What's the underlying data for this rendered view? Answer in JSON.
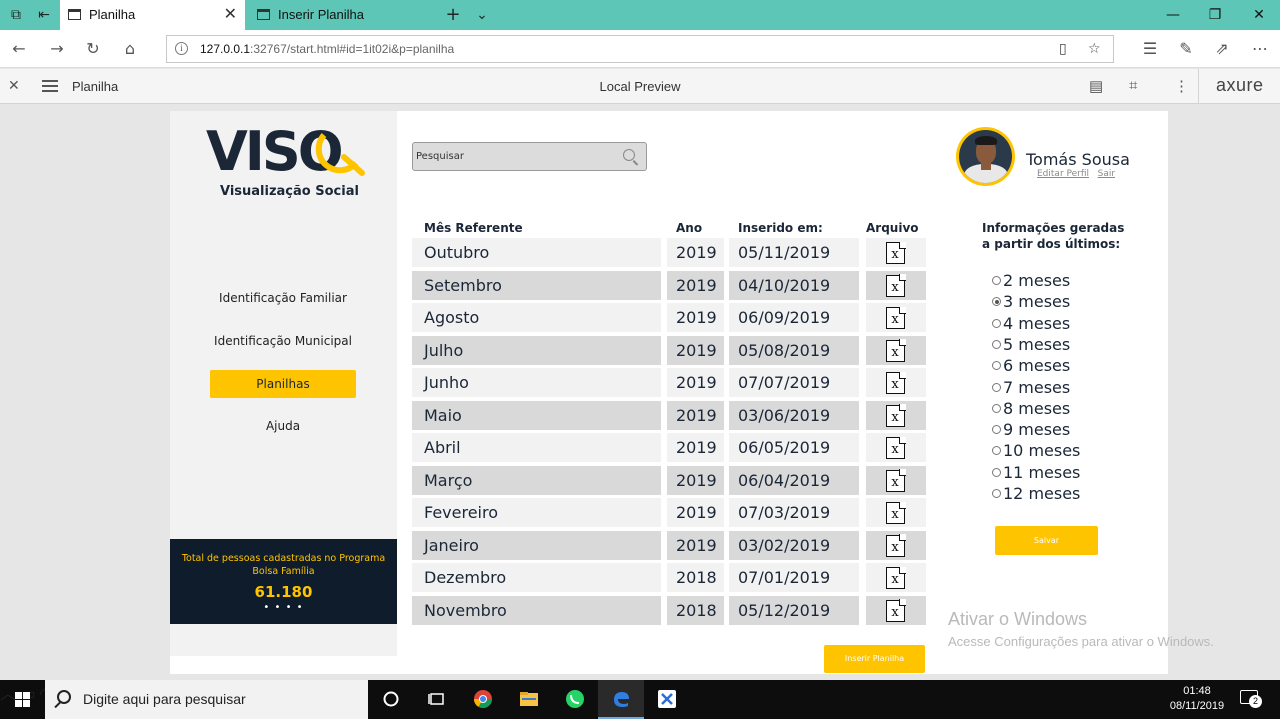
{
  "browser": {
    "tabs": [
      {
        "label": "Planilha"
      },
      {
        "label": "Inserir Planilha"
      }
    ],
    "url_host": "127.0.0.1",
    "url_rest": ":32767/start.html#id=1it02i&p=planilha"
  },
  "axure": {
    "page_name": "Planilha",
    "center_title": "Local Preview",
    "brand": "axure"
  },
  "sidebar": {
    "logo_text": "VISO",
    "logo_subtitle": "Visualização Social",
    "items": [
      {
        "label": "Identificação Familiar",
        "active": false
      },
      {
        "label": "Identificação Municipal",
        "active": false
      },
      {
        "label": "Planilhas",
        "active": true
      },
      {
        "label": "Ajuda",
        "active": false
      }
    ],
    "stats": {
      "label": "Total de pessoas cadastradas no Programa Bolsa Família",
      "value": "61.180",
      "dots": "• • • •"
    }
  },
  "search": {
    "placeholder": "Pesquisar"
  },
  "table": {
    "headers": {
      "mes": "Mês Referente",
      "ano": "Ano",
      "inserido": "Inserido em:",
      "arquivo": "Arquivo"
    },
    "file_icon_glyph": "x",
    "rows": [
      {
        "mes": "Outubro",
        "ano": "2019",
        "inserido": "05/11/2019"
      },
      {
        "mes": "Setembro",
        "ano": "2019",
        "inserido": "04/10/2019"
      },
      {
        "mes": "Agosto",
        "ano": "2019",
        "inserido": "06/09/2019"
      },
      {
        "mes": "Julho",
        "ano": "2019",
        "inserido": "05/08/2019"
      },
      {
        "mes": "Junho",
        "ano": "2019",
        "inserido": "07/07/2019"
      },
      {
        "mes": "Maio",
        "ano": "2019",
        "inserido": "03/06/2019"
      },
      {
        "mes": "Abril",
        "ano": "2019",
        "inserido": "06/05/2019"
      },
      {
        "mes": "Março",
        "ano": "2019",
        "inserido": "06/04/2019"
      },
      {
        "mes": "Fevereiro",
        "ano": "2019",
        "inserido": "07/03/2019"
      },
      {
        "mes": "Janeiro",
        "ano": "2019",
        "inserido": "03/02/2019"
      },
      {
        "mes": "Dezembro",
        "ano": "2018",
        "inserido": "07/01/2019"
      },
      {
        "mes": "Novembro",
        "ano": "2018",
        "inserido": "05/12/2019"
      }
    ]
  },
  "insert_button": "Inserir Planilha",
  "user": {
    "name": "Tomás Sousa",
    "edit_link": "Editar Perfil",
    "logout_link": "Sair"
  },
  "period": {
    "title_line1": "Informações geradas",
    "title_line2": "a partir dos últimos:",
    "options": [
      "2 meses",
      "3 meses",
      "4 meses",
      "5 meses",
      "6 meses",
      "7 meses",
      "8 meses",
      "9 meses",
      "10 meses",
      "11 meses",
      "12 meses"
    ],
    "selected": "3 meses",
    "save_label": "Salvar"
  },
  "watermark": {
    "line1": "Ativar o Windows",
    "line2": "Acesse Configurações para ativar o Windows."
  },
  "taskbar": {
    "search_placeholder": "Digite aqui para pesquisar",
    "time": "01:48",
    "date": "08/11/2019",
    "notification_count": "2"
  }
}
